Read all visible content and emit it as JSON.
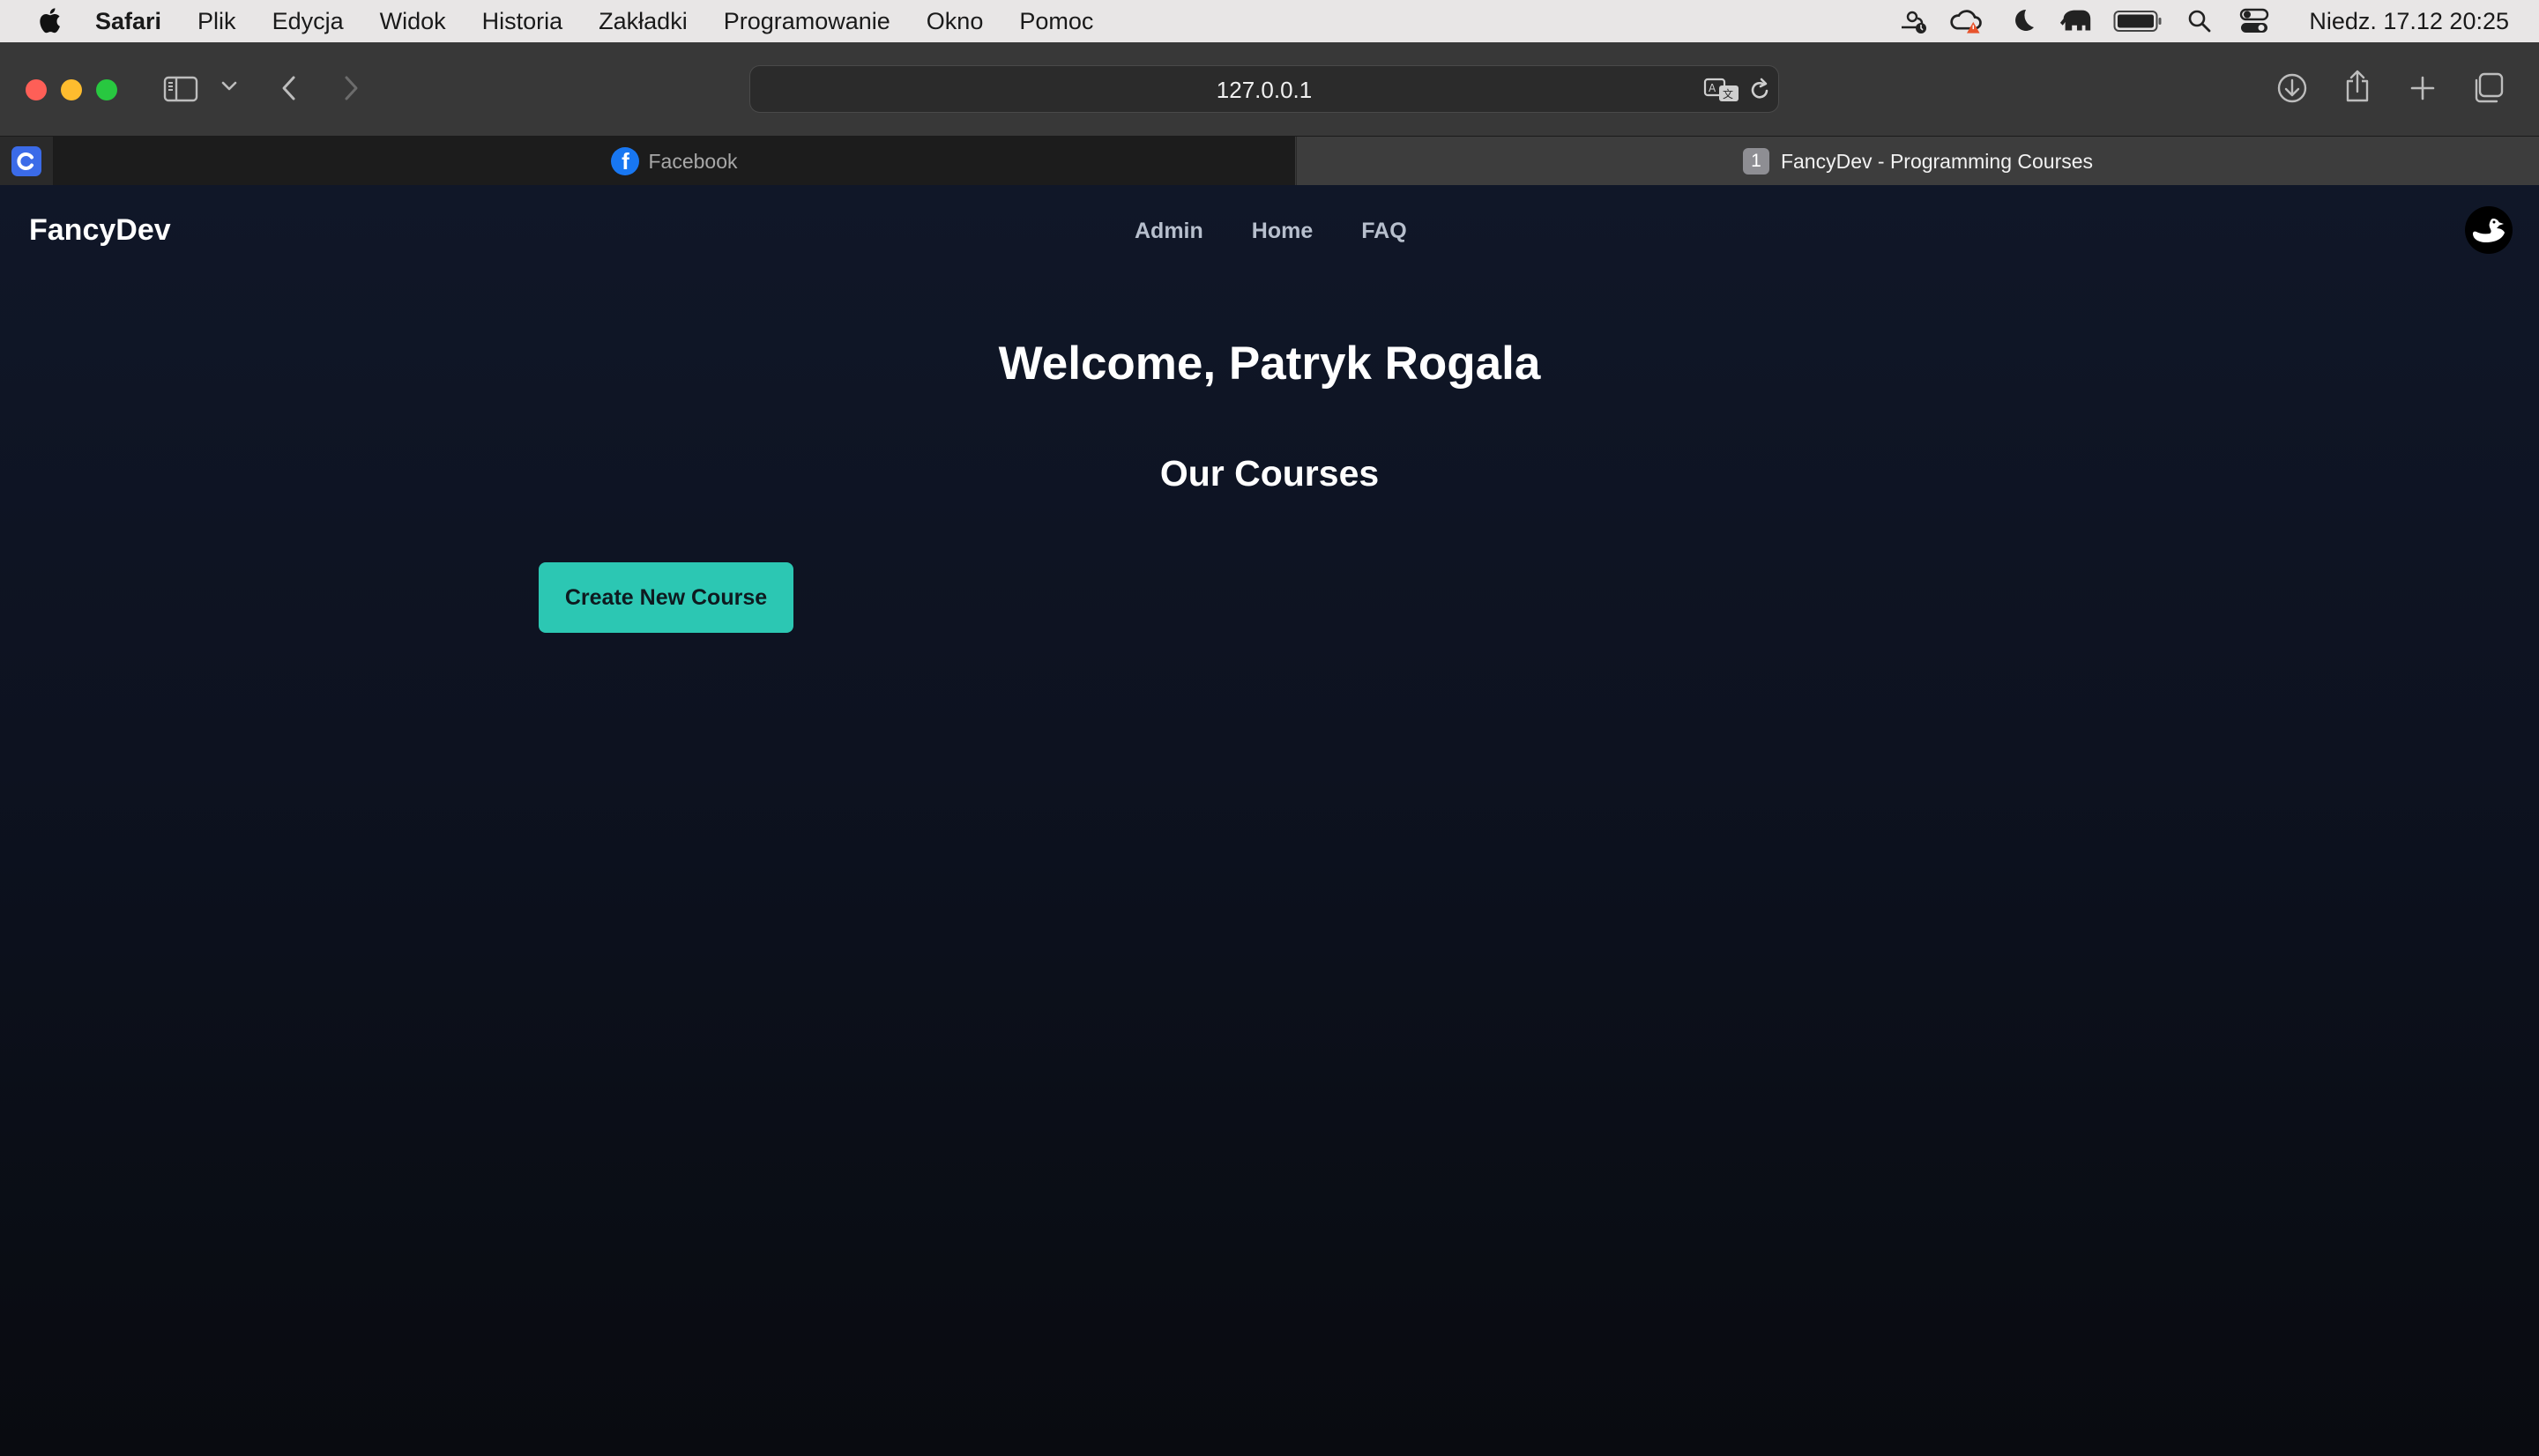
{
  "menubar": {
    "apple_icon": "apple-logo-icon",
    "app_name": "Safari",
    "menus": [
      "Plik",
      "Edycja",
      "Widok",
      "Historia",
      "Zakładki",
      "Programowanie",
      "Okno",
      "Pomoc"
    ],
    "status_icons": [
      "weather-icon",
      "creative-cloud-icon",
      "moon-icon",
      "elephant-icon",
      "battery-icon",
      "search-icon",
      "control-center-icon"
    ],
    "clock": "Niedz. 17.12  20:25"
  },
  "toolbar": {
    "url": "127.0.0.1",
    "icons": [
      "sidebar-icon",
      "chevron-down-icon",
      "back-icon",
      "forward-icon",
      "translate-icon",
      "reload-icon",
      "download-icon",
      "share-icon",
      "new-tab-icon",
      "tab-overview-icon"
    ]
  },
  "tabs": [
    {
      "title": "Facebook",
      "icon": "facebook-icon",
      "active": false
    },
    {
      "title": "FancyDev - Programming Courses",
      "badge": "1",
      "active": true
    }
  ],
  "page": {
    "brand": "FancyDev",
    "nav": [
      "Admin",
      "Home",
      "FAQ"
    ],
    "avatar_icon": "duck-avatar-icon",
    "welcome": "Welcome, Patryk Rogala",
    "section_title": "Our Courses",
    "create_button": "Create New Course"
  },
  "colors": {
    "accent": "#2cc7b3",
    "page_bg": "#0d1220",
    "menubar_bg": "#e8e6e6",
    "toolbar_bg": "#383838"
  }
}
